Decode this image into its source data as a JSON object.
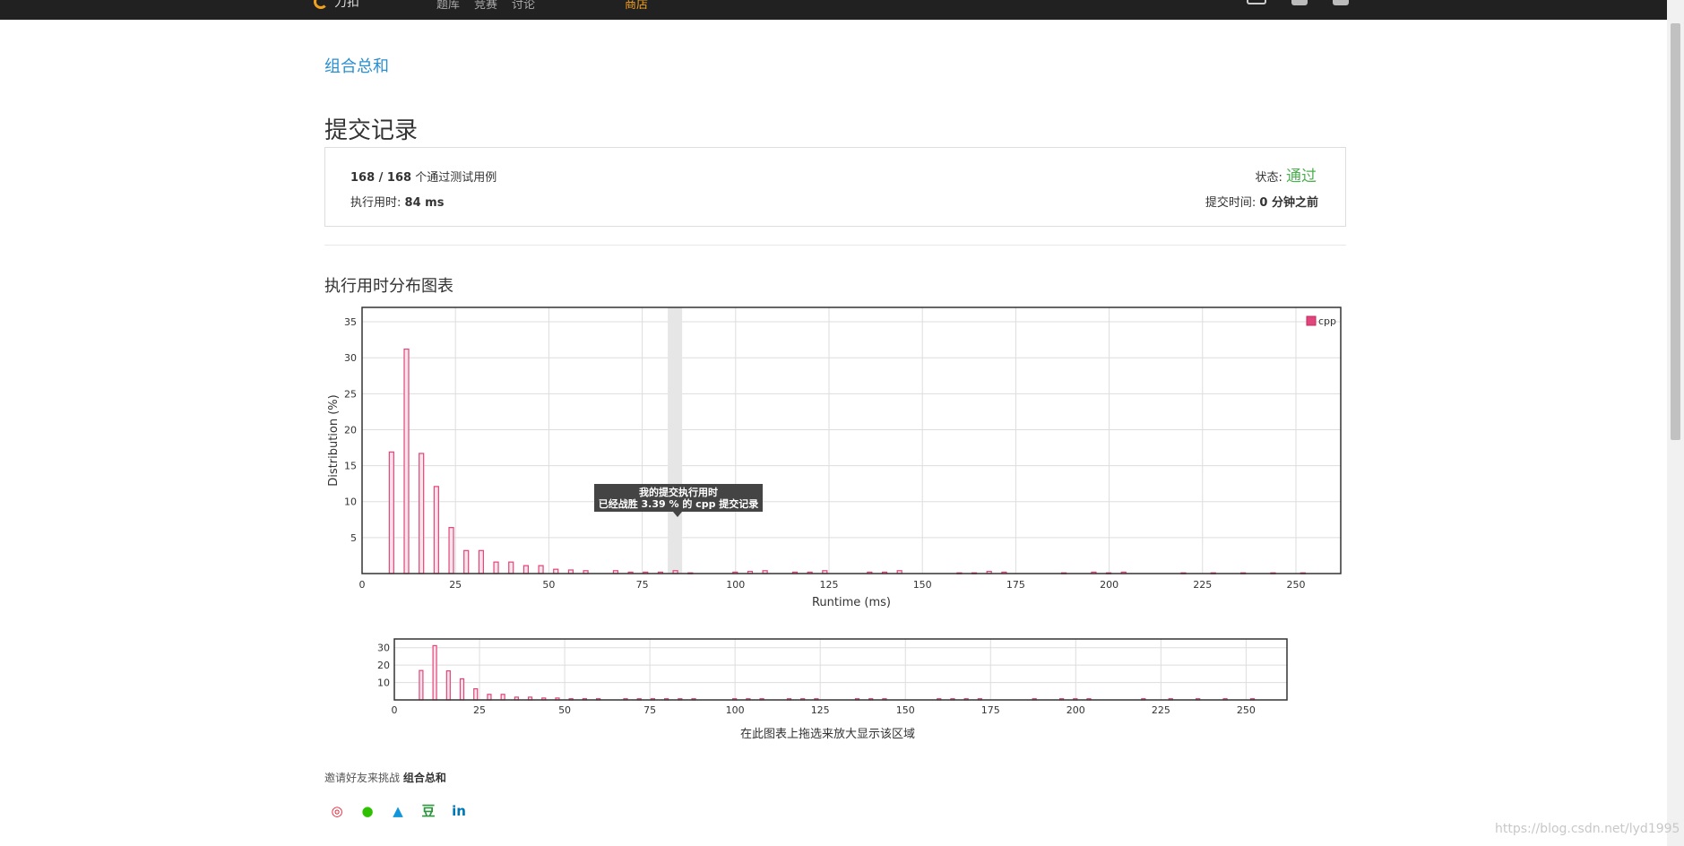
{
  "nav": {
    "logo_text": "力扣",
    "items": [
      "",
      "题库",
      "竞赛",
      "讨论",
      "",
      "",
      "商店"
    ],
    "active_index": 6
  },
  "problem": {
    "title": "组合总和"
  },
  "submission": {
    "section_title": "提交记录",
    "passed": "168 / 168",
    "passed_suffix": "个通过测试用例",
    "runtime_label": "执行用时:",
    "runtime_value": "84 ms",
    "status_label": "状态:",
    "status_value": "通过",
    "time_label": "提交时间:",
    "time_value": "0 分钟之前"
  },
  "chart_title": "执行用时分布图表",
  "tooltip": {
    "line1": "我的提交执行用时",
    "line2": "已经战胜 3.39 % 的 cpp 提交记录"
  },
  "chart_data": {
    "type": "bar",
    "xlabel": "Runtime (ms)",
    "ylabel": "Distribution (%)",
    "xlim": [
      0,
      262
    ],
    "ylim": [
      0,
      37
    ],
    "xticks": [
      0,
      25,
      50,
      75,
      100,
      125,
      150,
      175,
      200,
      225,
      250
    ],
    "yticks": [
      5,
      10,
      15,
      20,
      25,
      30,
      35
    ],
    "legend": "cpp",
    "legend_position": "top-right",
    "highlight_x": 84,
    "series": [
      {
        "name": "cpp",
        "x": [
          8,
          12,
          16,
          20,
          24,
          28,
          32,
          36,
          40,
          44,
          48,
          52,
          56,
          60,
          68,
          72,
          76,
          80,
          84,
          88,
          100,
          104,
          108,
          116,
          120,
          124,
          136,
          140,
          144,
          160,
          164,
          168,
          172,
          188,
          196,
          200,
          204,
          220,
          228,
          236,
          244,
          252
        ],
        "values": [
          16.9,
          31.2,
          16.7,
          12.1,
          6.4,
          3.2,
          3.2,
          1.6,
          1.6,
          1.1,
          1.1,
          0.6,
          0.5,
          0.4,
          0.4,
          0.2,
          0.2,
          0.2,
          0.4,
          0.1,
          0.2,
          0.3,
          0.4,
          0.2,
          0.2,
          0.4,
          0.2,
          0.2,
          0.4,
          0.1,
          0.1,
          0.3,
          0.2,
          0.1,
          0.2,
          0.1,
          0.2,
          0.1,
          0.1,
          0.1,
          0.1,
          0.1
        ]
      }
    ],
    "navigator": {
      "xticks": [
        0,
        25,
        50,
        75,
        100,
        125,
        150,
        175,
        200,
        225,
        250
      ],
      "yticks": [
        10,
        20,
        30
      ],
      "ylim": [
        0,
        35
      ],
      "caption": "在此图表上拖选来放大显示该区域"
    }
  },
  "invite": {
    "prefix": "邀请好友来挑战",
    "title": "组合总和"
  },
  "share": [
    {
      "icon": "weibo-icon",
      "glyph": "◎",
      "color": "#e6162d"
    },
    {
      "icon": "wechat-icon",
      "glyph": "●",
      "color": "#2dc100"
    },
    {
      "icon": "qq-icon",
      "glyph": "▲",
      "color": "#1296db"
    },
    {
      "icon": "douban-icon",
      "glyph": "豆",
      "color": "#2e963d"
    },
    {
      "icon": "linkedin-icon",
      "glyph": "in",
      "color": "#0077b5"
    }
  ],
  "watermark": "https://blog.csdn.net/lyd1995"
}
